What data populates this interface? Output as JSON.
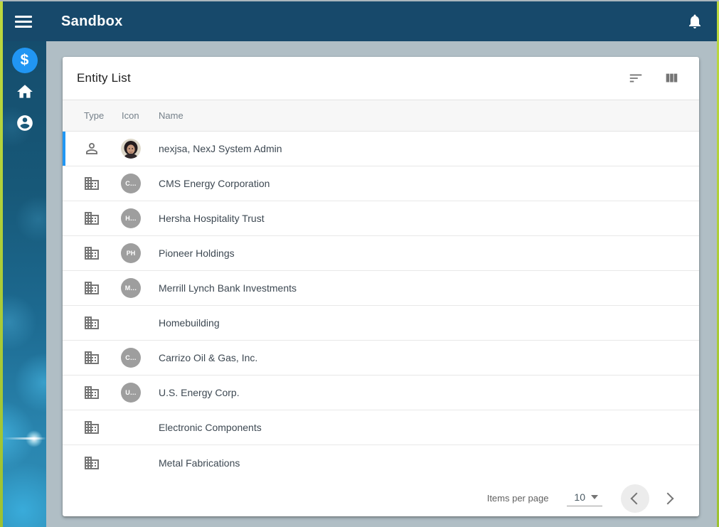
{
  "app": {
    "title": "Sandbox"
  },
  "sidebar": {
    "items": [
      {
        "id": "money",
        "icon": "dollar-icon",
        "active": true,
        "glyph": "$"
      },
      {
        "id": "home",
        "icon": "home-icon",
        "active": false
      },
      {
        "id": "profile",
        "icon": "account-icon",
        "active": false
      }
    ]
  },
  "card": {
    "title": "Entity List",
    "actions": [
      "sort-icon",
      "view-columns-icon"
    ]
  },
  "table": {
    "columns": {
      "type": "Type",
      "icon": "Icon",
      "name": "Name"
    },
    "rows": [
      {
        "type": "person",
        "avatar": "photo",
        "name": "nexjsa, NexJ System Admin",
        "selected": true
      },
      {
        "type": "company",
        "avatar": "C…",
        "name": "CMS Energy Corporation"
      },
      {
        "type": "company",
        "avatar": "H…",
        "name": "Hersha Hospitality Trust"
      },
      {
        "type": "company",
        "avatar": "PH",
        "name": "Pioneer Holdings"
      },
      {
        "type": "company",
        "avatar": "M…",
        "name": "Merrill Lynch Bank Investments"
      },
      {
        "type": "company",
        "avatar": null,
        "name": "Homebuilding"
      },
      {
        "type": "company",
        "avatar": "C…",
        "name": "Carrizo Oil & Gas, Inc."
      },
      {
        "type": "company",
        "avatar": "U…",
        "name": "U.S. Energy Corp."
      },
      {
        "type": "company",
        "avatar": null,
        "name": "Electronic Components"
      },
      {
        "type": "company",
        "avatar": null,
        "name": "Metal Fabrications"
      }
    ]
  },
  "pagination": {
    "label": "Items per page",
    "page_size": "10"
  },
  "colors": {
    "appbar": "#17496b",
    "accent": "#2196f3",
    "content_bg": "#b0bec5",
    "edge_green": "#a8c838",
    "avatar_bg": "#9e9e9e"
  }
}
